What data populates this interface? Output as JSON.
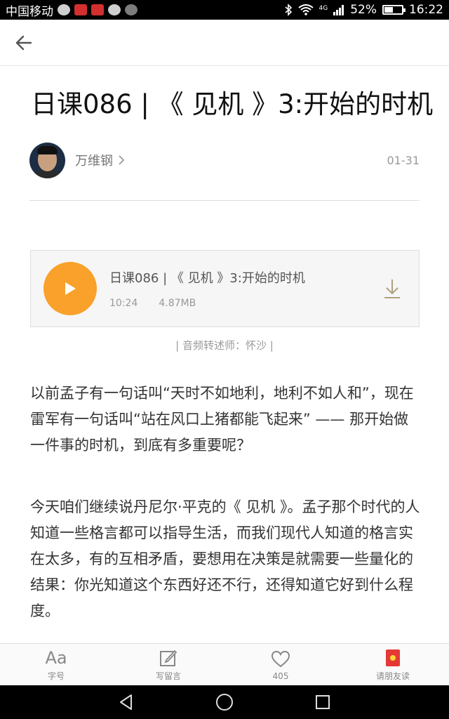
{
  "status_bar": {
    "carrier": "中国移动",
    "network_label": "4G",
    "battery_percent": "52%",
    "battery_level": 0.52,
    "time": "16:22"
  },
  "nav": {
    "back_icon": "arrow-left-icon"
  },
  "article": {
    "title": "日课086 | 《 见机 》3:开始的时机",
    "author": "万维钢",
    "date": "01-31"
  },
  "audio": {
    "title": "日课086 | 《 见机 》3:开始的时机",
    "duration": "10:24",
    "size": "4.87MB",
    "narrator": "| 音频转述师：怀沙 |",
    "accent_color": "#f9a12b"
  },
  "body": {
    "paragraphs": [
      "以前孟子有一句话叫“天时不如地利，地利不如人和”，现在雷军有一句话叫“站在风口上猪都能飞起来” —— 那开始做一件事的时机，到底有多重要呢？",
      "今天咱们继续说丹尼尔·平克的《 见机 》。孟子那个时代的人知道一些格言都可以指导生活，而我们现代人知道的格言实在太多，有的互相矛盾，要想用在决策是就需要一些量化的结果：你光知道这个东西好还不行，还得知道它好到什么程度。"
    ]
  },
  "toolbar": {
    "font_icon_text": "Aa",
    "font_label": "字号",
    "comment_label": "写留言",
    "like_count": "405",
    "share_label": "请朋友读"
  }
}
